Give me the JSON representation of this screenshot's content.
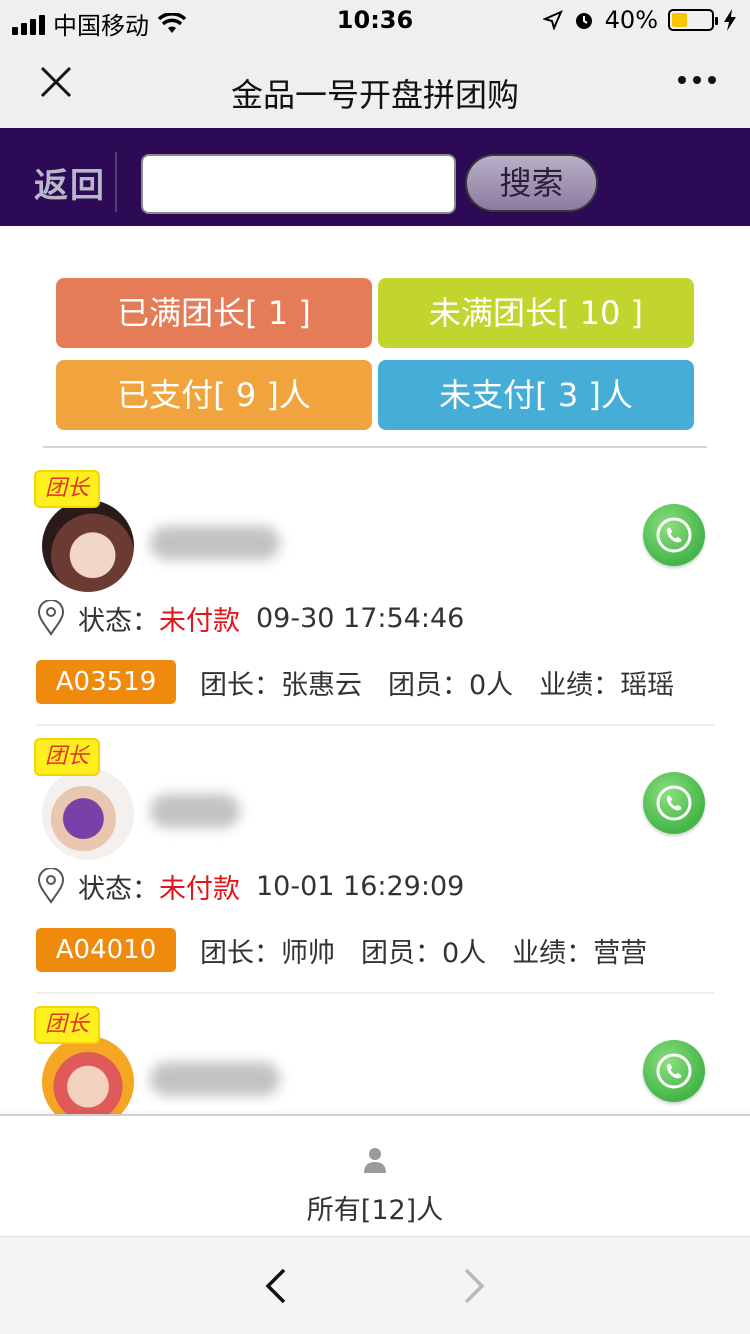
{
  "status_bar": {
    "carrier": "中国移动",
    "time": "10:36",
    "battery": "40%",
    "battery_level": 0.4
  },
  "nav": {
    "title": "金品一号开盘拼团购"
  },
  "search": {
    "back_label": "返回",
    "input_value": "",
    "placeholder": "",
    "button_label": "搜索"
  },
  "filters": {
    "full_leaders": "已满团长[ 1 ]",
    "not_full_leaders": "未满团长[ 10 ]",
    "paid": "已支付[ 9 ]人",
    "unpaid": "未支付[ 3 ]人"
  },
  "members": [
    {
      "tag": "团长",
      "status_label": "状态：",
      "status_value": "未付款",
      "time": "09-30 17:54:46",
      "code": "A03519",
      "leader_label": "团长：",
      "leader": "张惠云",
      "members_label": "团员：",
      "members_count": "0人",
      "perf_label": "业绩：",
      "perf": "瑶瑶"
    },
    {
      "tag": "团长",
      "status_label": "状态：",
      "status_value": "未付款",
      "time": "10-01 16:29:09",
      "code": "A04010",
      "leader_label": "团长：",
      "leader": "师帅",
      "members_label": "团员：",
      "members_count": "0人",
      "perf_label": "业绩：",
      "perf": "营营"
    },
    {
      "tag": "团长"
    }
  ],
  "summary": {
    "all_label": "所有[12]人"
  },
  "colors": {
    "header_purple": "#2d0a56",
    "unpaid_red": "#e0171b",
    "code_orange": "#f08a0c"
  }
}
